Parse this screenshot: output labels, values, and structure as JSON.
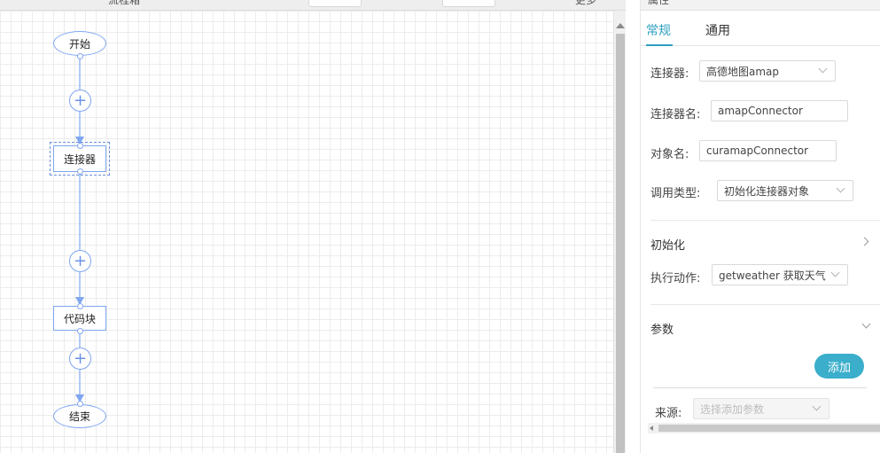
{
  "toolbar": {
    "title_clip": "流程箱",
    "more_label": "更多"
  },
  "flow": {
    "start_label": "开始",
    "connector_label": "连接器",
    "code_label": "代码块",
    "end_label": "结束",
    "add_symbol": "+"
  },
  "panel": {
    "header_clip": "属性",
    "tabs": [
      {
        "label": "常规",
        "active": true
      },
      {
        "label": "通用",
        "active": false
      }
    ],
    "fields": {
      "connector": {
        "label": "连接器:",
        "value": "高德地图amap"
      },
      "connector_name": {
        "label": "连接器名:",
        "value": "amapConnector"
      },
      "object_name": {
        "label": "对象名:",
        "value": "curamapConnector"
      },
      "call_type": {
        "label": "调用类型:",
        "value": "初始化连接器对象"
      },
      "init_section": {
        "label": "初始化"
      },
      "action": {
        "label": "执行动作:",
        "value": "getweather 获取天气"
      },
      "params_section": {
        "label": "参数"
      },
      "add_button": "添加",
      "source": {
        "label": "来源:",
        "placeholder": "选择添加参数"
      }
    }
  },
  "colors": {
    "accent": "#2f9fc3",
    "node_border": "#7fa6f0",
    "add_button_bg": "#3aaecb"
  }
}
